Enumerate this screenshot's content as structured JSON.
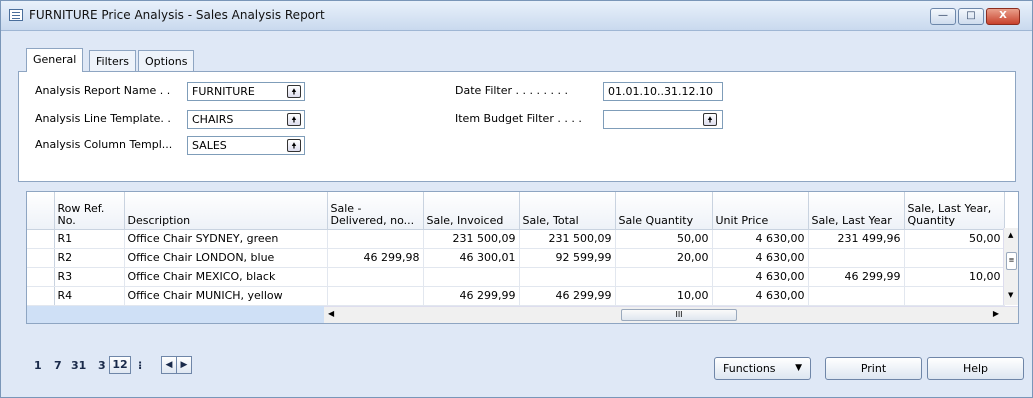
{
  "window": {
    "title": "FURNITURE Price Analysis - Sales Analysis Report",
    "minimize": "—",
    "maximize": "□",
    "close": "X"
  },
  "tabs": [
    {
      "label": "General",
      "active": true
    },
    {
      "label": "Filters",
      "active": false
    },
    {
      "label": "Options",
      "active": false
    }
  ],
  "general": {
    "analysis_report_name_label": "Analysis Report Name . .",
    "analysis_report_name_value": "FURNITURE",
    "analysis_line_template_label": "Analysis Line Template. .",
    "analysis_line_template_value": "CHAIRS",
    "analysis_column_template_label": "Analysis Column Templ...",
    "analysis_column_template_value": "SALES",
    "date_filter_label": "Date Filter . . . . . . . .",
    "date_filter_value": "01.01.10..31.12.10",
    "item_budget_filter_label": "Item Budget Filter . . . .",
    "item_budget_filter_value": ""
  },
  "grid": {
    "headers": [
      "Row Ref. No.",
      "Description",
      "Sale - Delivered, no...",
      "Sale, Invoiced",
      "Sale, Total",
      "Sale Quantity",
      "Unit Price",
      "Sale, Last Year",
      "Sale, Last Year, Quantity"
    ],
    "rows": [
      [
        "R1",
        "Office Chair SYDNEY, green",
        "",
        "231 500,09",
        "231 500,09",
        "50,00",
        "4 630,00",
        "231 499,96",
        "50,00"
      ],
      [
        "R2",
        "Office Chair LONDON, blue",
        "46 299,98",
        "46 300,01",
        "92 599,99",
        "20,00",
        "4 630,00",
        "",
        ""
      ],
      [
        "R3",
        "Office Chair MEXICO, black",
        "",
        "",
        "",
        "",
        "4 630,00",
        "46 299,99",
        "10,00"
      ],
      [
        "R4",
        "Office Chair MUNICH, yellow",
        "",
        "46 299,99",
        "46 299,99",
        "10,00",
        "4 630,00",
        "",
        ""
      ]
    ],
    "scroll_thumb": "III"
  },
  "pager": {
    "items": [
      "1",
      "7",
      "31",
      "3",
      "12",
      "⁝"
    ],
    "prev": "◀",
    "next": "▶"
  },
  "buttons": {
    "functions": "Functions",
    "functions_arrow": "▼",
    "print": "Print",
    "help": "Help"
  },
  "icons": {
    "lookup": "🠝"
  }
}
